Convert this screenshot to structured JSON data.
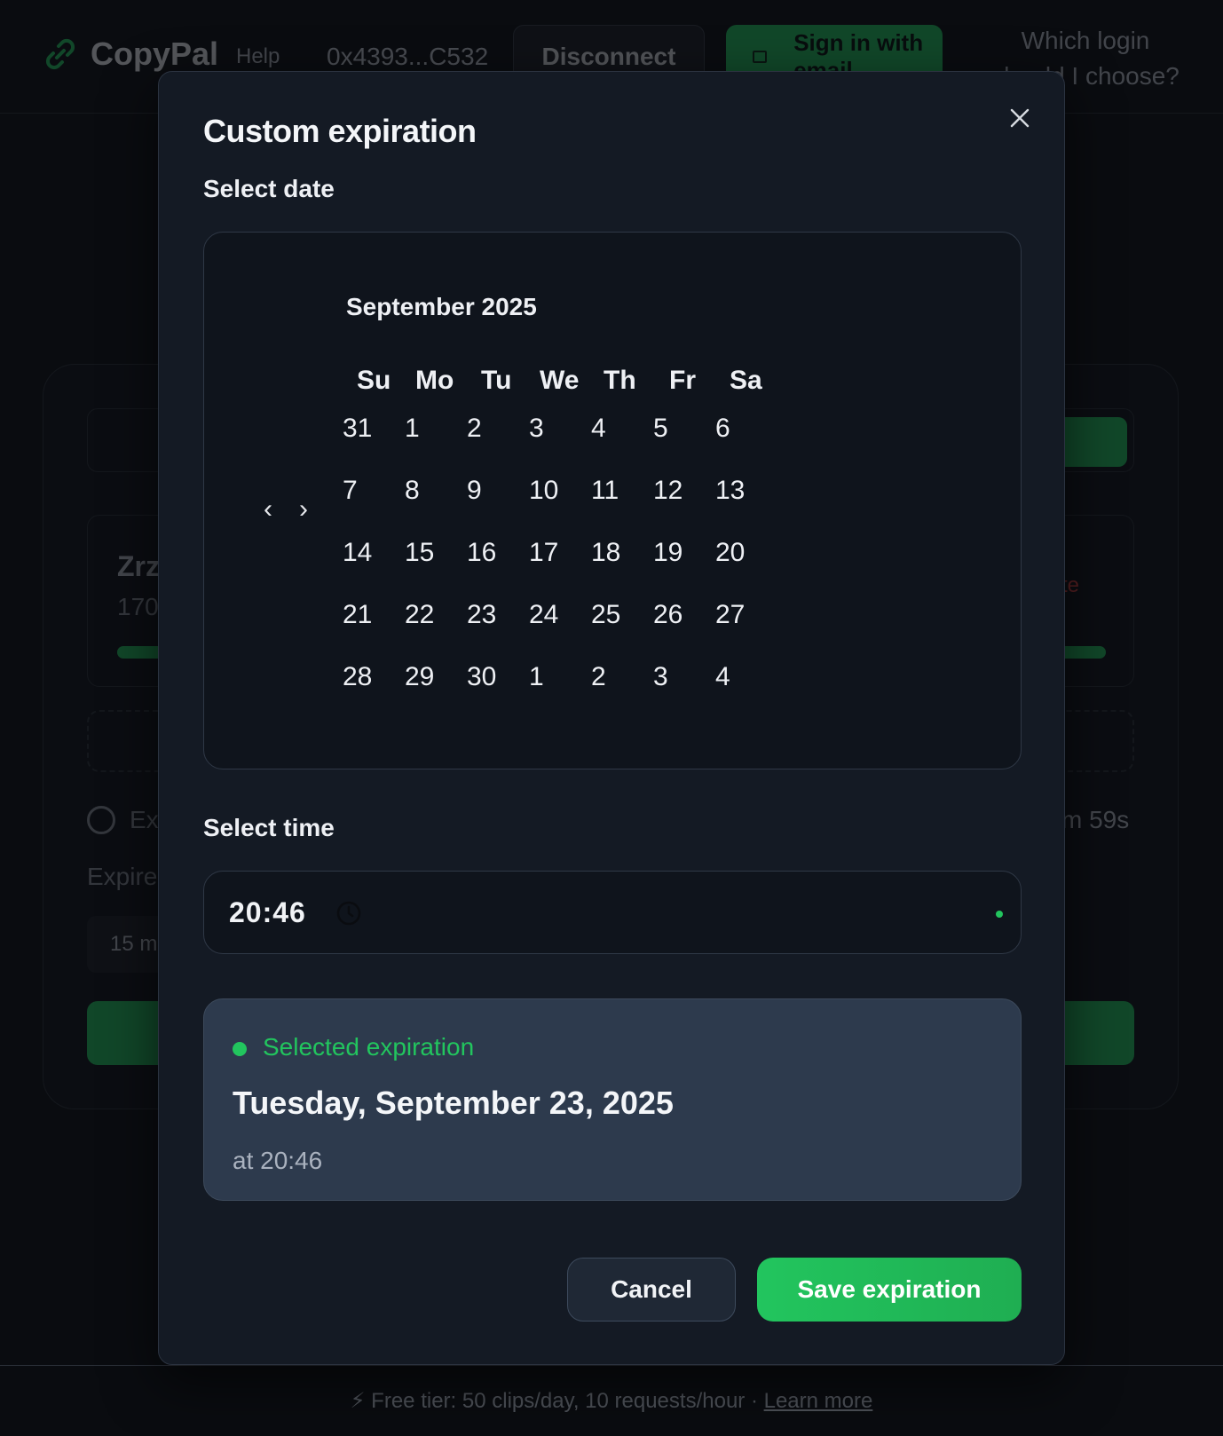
{
  "header": {
    "brand": "CopyPal",
    "help_label": "Help",
    "wallet_address": "0x4393...C532",
    "disconnect_label": "Disconnect",
    "signin_label": "Sign in with email",
    "which_login_label": "Which login should I choose?"
  },
  "background": {
    "item_title": "Zrz",
    "item_subtitle": "170",
    "delete_label": "te",
    "expires_label": "Ex",
    "timer_label": "m 59s",
    "expire_select_label": "Expire",
    "duration_value": "15 m"
  },
  "footer": {
    "text": "⚡ Free tier: 50 clips/day, 10 requests/hour · ",
    "link": "Learn more"
  },
  "modal": {
    "title": "Custom expiration",
    "select_date_label": "Select date",
    "select_time_label": "Select time",
    "calendar": {
      "month_label": "September 2025",
      "prev_label": "‹",
      "next_label": "›",
      "weekdays": [
        "Su",
        "Mo",
        "Tu",
        "We",
        "Th",
        "Fr",
        "Sa"
      ],
      "weeks": [
        [
          "31",
          "1",
          "2",
          "3",
          "4",
          "5",
          "6"
        ],
        [
          "7",
          "8",
          "9",
          "10",
          "11",
          "12",
          "13"
        ],
        [
          "14",
          "15",
          "16",
          "17",
          "18",
          "19",
          "20"
        ],
        [
          "21",
          "22",
          "23",
          "24",
          "25",
          "26",
          "27"
        ],
        [
          "28",
          "29",
          "30",
          "1",
          "2",
          "3",
          "4"
        ]
      ]
    },
    "time_value": "20:46",
    "summary": {
      "label": "Selected expiration",
      "date": "Tuesday, September 23, 2025",
      "time": "at 20:46"
    },
    "cancel_label": "Cancel",
    "save_label": "Save expiration"
  },
  "colors": {
    "accent": "#22c55e",
    "background": "#0a0c10",
    "modal": "#141a24",
    "summary": "#2d3a4d"
  },
  "icons": {
    "brand": "link-icon",
    "close": "close-icon",
    "time": "clock-icon",
    "mail": "mail-icon"
  }
}
